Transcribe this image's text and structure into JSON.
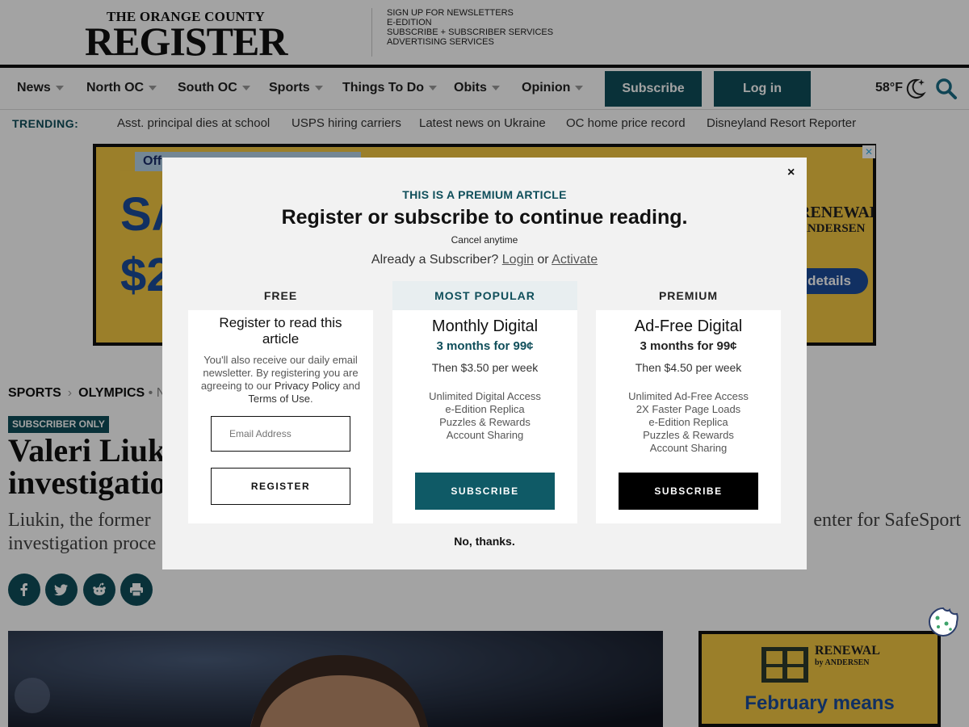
{
  "masthead": {
    "logo_top": "THE ORANGE COUNTY",
    "logo_main": "REGISTER",
    "links": [
      "SIGN UP FOR NEWSLETTERS",
      "E-EDITION",
      "SUBSCRIBE + SUBSCRIBER SERVICES",
      "ADVERTISING SERVICES"
    ]
  },
  "nav": {
    "items": [
      "News",
      "North OC",
      "South OC",
      "Sports",
      "Things To Do",
      "Obits",
      "Opinion"
    ],
    "subscribe_label": "Subscribe",
    "login_label": "Log in",
    "temperature": "58°F"
  },
  "trending": {
    "label": "TRENDING:",
    "links": [
      "Asst. principal dies at school",
      "USPS hiring carriers",
      "Latest news on Ukraine",
      "OC home price record",
      "Disneyland Resort Reporter"
    ]
  },
  "ad_top": {
    "offer": "Off",
    "big1": "SA",
    "big2": "$2",
    "brand_line1": "RENEWAL",
    "brand_line2": "ANDERSEN",
    "details": "details"
  },
  "article": {
    "section": "SPORTS",
    "subsection": "OLYMPICS",
    "suffix": "• New",
    "badge": "SUBSCRIBER ONLY",
    "headline_1": "Valeri Liuk",
    "headline_2": "investigatio",
    "dek_1": "Liukin, the former",
    "dek_1_right": "enter for SafeSport",
    "dek_2": "investigation proce"
  },
  "ad_side": {
    "brand_line1": "RENEWAL",
    "brand_line2": "by ANDERSEN",
    "text": "February means"
  },
  "modal": {
    "close_label": "×",
    "premium_label": "THIS IS A PREMIUM ARTICLE",
    "title": "Register or subscribe to continue reading.",
    "cancel_note": "Cancel anytime",
    "already_text": "Already a Subscriber?",
    "login_link": "Login",
    "or_text": "or",
    "activate_link": "Activate",
    "no_thanks": "No, thanks.",
    "free": {
      "head": "FREE",
      "title": "Register to read this article",
      "desc_1": "You'll also receive our daily email newsletter. By registering you are agreeing to our",
      "privacy": "Privacy Policy",
      "and": "and",
      "terms": "Terms of Use",
      "period": ".",
      "email_placeholder": "Email Address",
      "register_label": "REGISTER"
    },
    "popular": {
      "head": "MOST POPULAR",
      "title": "Monthly Digital",
      "price": "3 months for 99¢",
      "then": "Then $3.50 per week",
      "features": [
        "Unlimited Digital Access",
        "e-Edition Replica",
        "Puzzles & Rewards",
        "Account Sharing"
      ],
      "button": "SUBSCRIBE"
    },
    "premium": {
      "head": "PREMIUM",
      "title": "Ad-Free Digital",
      "price": "3 months for 99¢",
      "then": "Then $4.50 per week",
      "features": [
        "Unlimited Ad-Free Access",
        "2X Faster Page Loads",
        "e-Edition Replica",
        "Puzzles & Rewards",
        "Account Sharing"
      ],
      "button": "SUBSCRIBE"
    }
  },
  "colors": {
    "brand_teal": "#0f4e5a",
    "ad_yellow": "#f3c743",
    "ad_blue": "#1b4c9a"
  },
  "icons": [
    "moon-star-icon",
    "search-icon",
    "facebook-icon",
    "twitter-icon",
    "reddit-icon",
    "print-icon",
    "cookie-icon",
    "close-icon"
  ]
}
